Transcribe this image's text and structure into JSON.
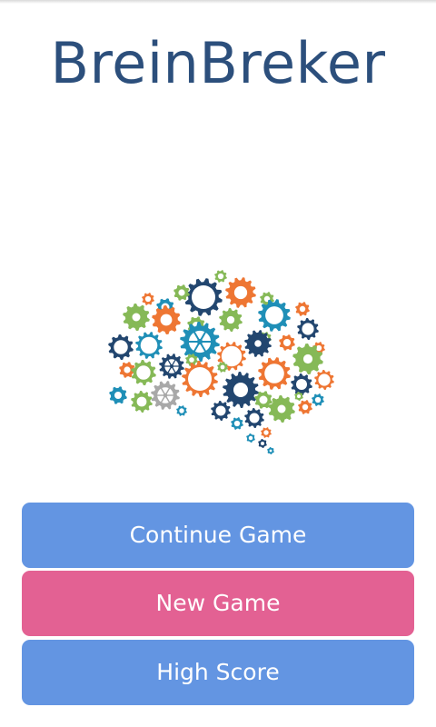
{
  "app": {
    "title": "BreinBreker"
  },
  "menu": {
    "continue_label": "Continue Game",
    "new_game_label": "New Game",
    "high_score_label": "High Score"
  },
  "colors": {
    "title": "#2c4f7c",
    "button_blue": "#6395e2",
    "button_pink": "#e36193",
    "gear_navy": "#22466f",
    "gear_teal": "#1f8fb7",
    "gear_orange": "#ee7633",
    "gear_green": "#86b957",
    "gear_gray": "#a8a8a8"
  },
  "logo": {
    "icon": "brain-gears-icon"
  }
}
